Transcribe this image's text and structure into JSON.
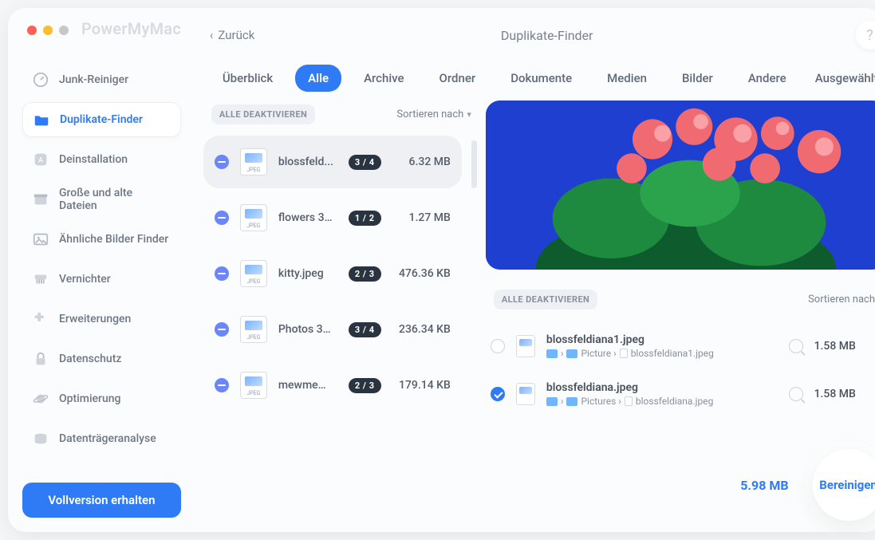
{
  "app_name": "PowerMyMac",
  "back_label": "Zurück",
  "page_title": "Duplikate-Finder",
  "help_label": "?",
  "sidebar": {
    "items": [
      {
        "label": "Junk-Reiniger",
        "icon": "gauge-icon"
      },
      {
        "label": "Duplikate-Finder",
        "icon": "folder-icon",
        "active": true
      },
      {
        "label": "Deinstallation",
        "icon": "app-icon"
      },
      {
        "label": "Große und alte Dateien",
        "icon": "box-icon"
      },
      {
        "label": "Ähnliche Bilder Finder",
        "icon": "image-icon"
      },
      {
        "label": "Vernichter",
        "icon": "shredder-icon"
      },
      {
        "label": "Erweiterungen",
        "icon": "plugin-icon"
      },
      {
        "label": "Datenschutz",
        "icon": "lock-icon"
      },
      {
        "label": "Optimierung",
        "icon": "planet-icon"
      },
      {
        "label": "Datenträgeranalyse",
        "icon": "disk-icon"
      }
    ],
    "full_version_label": "Vollversion erhalten"
  },
  "tabs": [
    "Überblick",
    "Alle",
    "Archive",
    "Ordner",
    "Dokumente",
    "Medien",
    "Bilder",
    "Andere",
    "Ausgewählt"
  ],
  "active_tab_index": 1,
  "left": {
    "deactivate_label": "ALLE DEAKTIVIEREN",
    "sort_label": "Sortieren nach",
    "groups": [
      {
        "name": "blossfeld...",
        "badge": "3 / 4",
        "size": "6.32 MB",
        "selected": true
      },
      {
        "name": "flowers 3…",
        "badge": "1 / 2",
        "size": "1.27 MB"
      },
      {
        "name": "kitty.jpeg",
        "badge": "2 / 3",
        "size": "476.36 KB"
      },
      {
        "name": "Photos 3…",
        "badge": "3 / 4",
        "size": "236.34 KB"
      },
      {
        "name": "mewme…",
        "badge": "2 / 3",
        "size": "179.14 KB"
      }
    ],
    "thumb_caption": "JPEG"
  },
  "right": {
    "deactivate_label": "ALLE DEAKTIVIEREN",
    "sort_label": "Sortieren nach",
    "files": [
      {
        "checked": false,
        "name": "blossfeldiana1.jpeg",
        "path_folder": "Picture",
        "path_file": "blossfeldiana1.jpeg",
        "size": "1.58 MB"
      },
      {
        "checked": true,
        "name": "blossfeldiana.jpeg",
        "path_folder": "Pictures",
        "path_file": "blossfeldiana.jpeg",
        "size": "1.58 MB"
      }
    ]
  },
  "footer": {
    "total": "5.98 MB",
    "clean_label": "Bereinigen"
  }
}
